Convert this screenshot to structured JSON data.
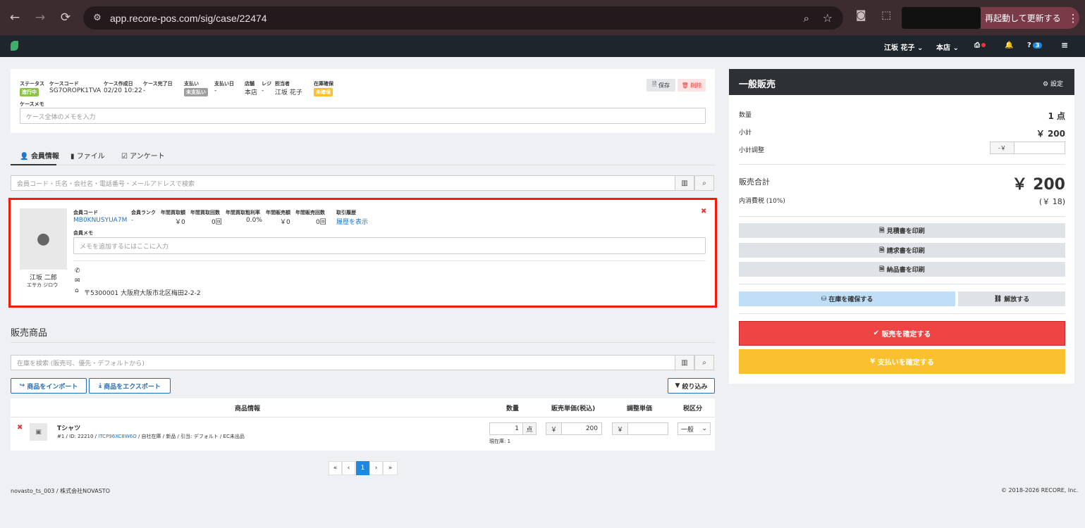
{
  "browser": {
    "url": "app.recore-pos.com/sig/case/22474",
    "relaunch_label": "再起動して更新する",
    "back_icon": "arrow-left-icon",
    "forward_icon": "arrow-right-icon",
    "reload_icon": "reload-icon"
  },
  "appbar": {
    "user": "江坂 花子",
    "store": "本店",
    "help_count": "3"
  },
  "case": {
    "status_label": "ステータス",
    "status_value": "進行中",
    "code_label": "ケースコード",
    "code_value": "SG7OROPK1TVA",
    "created_label": "ケース作成日",
    "created_value": "02/20 10:22",
    "done_label": "ケース完了日",
    "done_value": "-",
    "payment_label": "支払い",
    "payment_value": "未支払い",
    "paydate_label": "支払い日",
    "paydate_value": "-",
    "store_label": "店舗",
    "store_value": "本店",
    "register_label": "レジ",
    "register_value": "-",
    "staff_label": "担当者",
    "staff_value": "江坂 花子",
    "stock_label": "在庫確保",
    "stock_value": "未確保",
    "save_label": "保存",
    "delete_label": "削除",
    "memo_label": "ケースメモ",
    "memo_placeholder": "ケース全体のメモを入力"
  },
  "tabs": [
    {
      "label": "会員情報"
    },
    {
      "label": "ファイル"
    },
    {
      "label": "アンケート"
    }
  ],
  "member_search_placeholder": "会員コード・氏名・会社名・電話番号・メールアドレスで検索",
  "member": {
    "name": "江坂 二郎",
    "kana": "エサカ ジロウ",
    "code_label": "会員コード",
    "code_value": "MB0KNUSYUA7M",
    "rank_label": "会員ランク",
    "rank_value": "-",
    "buy_amount_label": "年間買取額",
    "buy_amount_value": "￥0",
    "buy_count_label": "年間買取回数",
    "buy_count_value": "0回",
    "buy_rate_label": "年間買取粗利率",
    "buy_rate_value": "0.0%",
    "sale_amount_label": "年間販売額",
    "sale_amount_value": "￥0",
    "sale_count_label": "年間販売回数",
    "sale_count_value": "0回",
    "history_label": "取引履歴",
    "history_link": "履歴を表示",
    "memo_label": "会員メモ",
    "memo_placeholder": "メモを追加するにはここに入力",
    "address": "〒5300001 大阪府大阪市北区梅田2-2-2"
  },
  "products": {
    "section_title": "販売商品",
    "search_placeholder": "在庫を検索 (販売可、優先・デフォルトから)",
    "import_label": "商品をインポート",
    "export_label": "商品をエクスポート",
    "filter_label": "絞り込み",
    "headers": {
      "info": "商品情報",
      "qty": "数量",
      "price": "販売単価(税込)",
      "adjust": "調整単価",
      "tax": "税区分"
    },
    "rows": [
      {
        "name": "Tシャツ",
        "meta_prefix": "#1 / ID: 22210 / ",
        "meta_link": "ITCP96XC8W6O",
        "meta_suffix": " / 自社在庫 / 新品 / 引当: デフォルト / EC未出品",
        "qty": "1",
        "qty_unit": "点",
        "stock": "現在庫: 1",
        "currency": "￥",
        "price": "200",
        "adjust": "",
        "tax": "一般"
      }
    ]
  },
  "pager": {
    "first": "«",
    "prev": "‹",
    "current": "1",
    "next": "›",
    "last": "»"
  },
  "footer": {
    "left": "novasto_ts_003 / 株式会社NOVASTO",
    "right": "© 2018-2026 RECORE, Inc."
  },
  "sidebar": {
    "title": "一般販売",
    "settings_label": "設定",
    "qty_label": "数量",
    "qty_value": "1 点",
    "subtotal_label": "小計",
    "subtotal_value": "￥ 200",
    "adjust_label": "小計調整",
    "adjust_prefix": "-￥",
    "total_label": "販売合計",
    "total_value": "￥ 200",
    "tax_label": "内消費税 (10%)",
    "tax_value": "(￥ 18)",
    "print_estimate": "見積書を印刷",
    "print_invoice": "請求書を印刷",
    "print_delivery": "納品書を印刷",
    "reserve_label": "在庫を確保する",
    "release_label": "解放する",
    "confirm_sale": "販売を確定する",
    "confirm_payment": "支払いを確定する"
  },
  "colors": {
    "accent_red": "#ef4444",
    "accent_yellow": "#fbc02d",
    "highlight_border": "#f51b0c",
    "status_green": "#8bc34a"
  }
}
